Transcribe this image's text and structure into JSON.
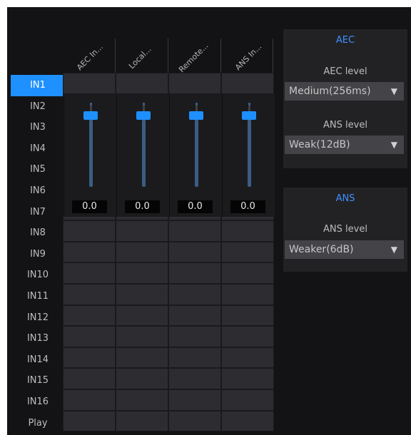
{
  "columns": [
    "AEC In...",
    "Local...",
    "Remote...",
    "ANS In..."
  ],
  "rows": [
    "IN1",
    "IN2",
    "IN3",
    "IN4",
    "IN5",
    "IN6",
    "IN7",
    "IN8",
    "IN9",
    "IN10",
    "IN11",
    "IN12",
    "IN13",
    "IN14",
    "IN15",
    "IN16",
    "Play"
  ],
  "selected_row": "IN1",
  "faders": [
    {
      "value": "0.0",
      "level": 0.85
    },
    {
      "value": "0.0",
      "level": 0.85
    },
    {
      "value": "0.0",
      "level": 0.85
    },
    {
      "value": "0.0",
      "level": 0.85
    }
  ],
  "aec_panel": {
    "title": "AEC",
    "aec_level_label": "AEC level",
    "aec_level_value": "Medium(256ms)",
    "ans_level_label": "ANS level",
    "ans_level_value": "Weak(12dB)"
  },
  "ans_panel": {
    "title": "ANS",
    "ans_level_label": "ANS level",
    "ans_level_value": "Weaker(6dB)"
  },
  "colors": {
    "accent": "#1e90ff",
    "background": "#131315",
    "panel": "#222224"
  }
}
